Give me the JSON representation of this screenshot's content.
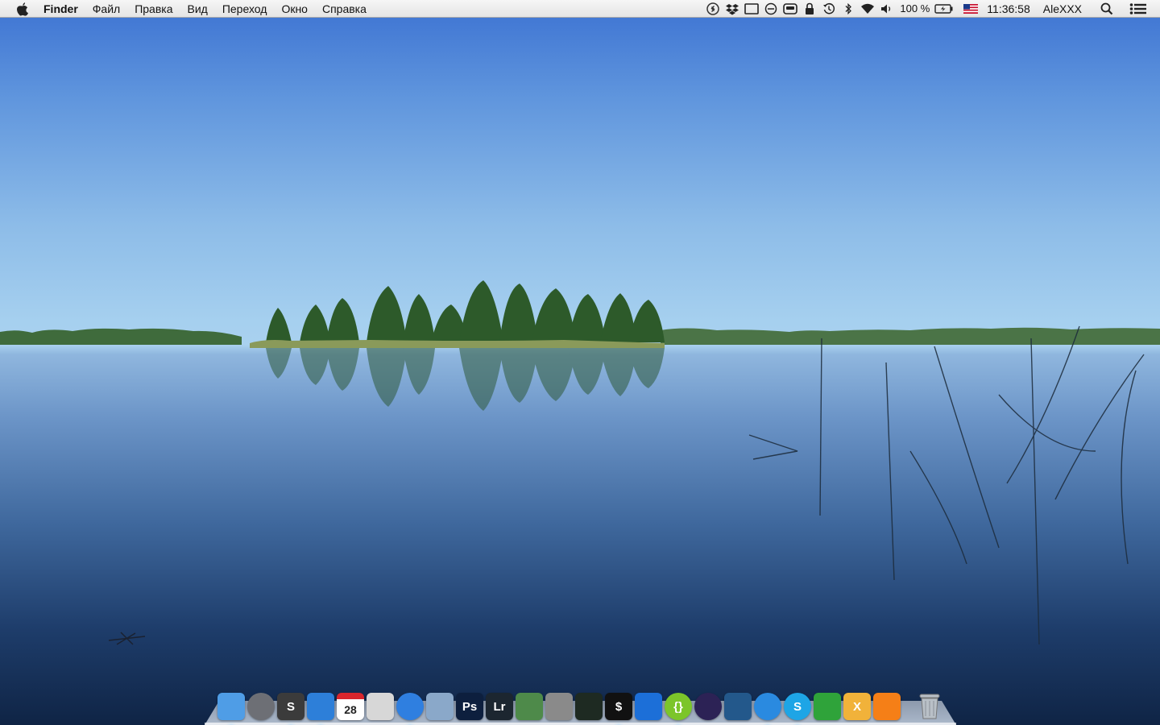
{
  "menubar": {
    "apple_icon": "apple-icon",
    "app_name": "Finder",
    "menus": [
      "Файл",
      "Правка",
      "Вид",
      "Переход",
      "Окно",
      "Справка"
    ],
    "status_icons": [
      "shazam-icon",
      "dropbox-icon",
      "display-icon",
      "sync-icon",
      "controller-icon",
      "lock-icon",
      "time-machine-icon",
      "bluetooth-icon",
      "wifi-icon",
      "volume-icon"
    ],
    "battery_percent": "100 %",
    "battery_icon": "battery-charging-icon",
    "input_source_icon": "us-flag-icon",
    "clock": "11:36:58",
    "user": "AleXXX",
    "spotlight_icon": "spotlight-search-icon",
    "notification_icon": "notification-center-icon"
  },
  "dock": {
    "items": [
      {
        "name": "finder-icon",
        "label": "",
        "color": "#4f9de6",
        "running": true
      },
      {
        "name": "launchpad-icon",
        "label": "",
        "color": "#6d6f75",
        "running": false
      },
      {
        "name": "sublime-text-icon",
        "label": "S",
        "color": "#3b3b3b",
        "running": true
      },
      {
        "name": "cyberduck-icon",
        "label": "",
        "color": "#2d7fd9",
        "running": true
      },
      {
        "name": "calendar-icon",
        "label": "28",
        "color": "#ffffff",
        "running": false
      },
      {
        "name": "calculator-icon",
        "label": "",
        "color": "#d7d7d7",
        "running": false
      },
      {
        "name": "safari-icon",
        "label": "",
        "color": "#2f7fe0",
        "running": true
      },
      {
        "name": "preview-icon",
        "label": "",
        "color": "#8aa8c9",
        "running": false
      },
      {
        "name": "photoshop-icon",
        "label": "Ps",
        "color": "#0d1f3e",
        "running": false
      },
      {
        "name": "lightroom-icon",
        "label": "Lr",
        "color": "#1c2630",
        "running": false
      },
      {
        "name": "image-capture-icon",
        "label": "",
        "color": "#4e8a4a",
        "running": false
      },
      {
        "name": "system-preferences-icon",
        "label": "",
        "color": "#8a8a8a",
        "running": false
      },
      {
        "name": "activity-monitor-icon",
        "label": "",
        "color": "#1e2a22",
        "running": false
      },
      {
        "name": "terminal-icon",
        "label": "$",
        "color": "#111111",
        "running": true
      },
      {
        "name": "webstorm-icon",
        "label": "",
        "color": "#1c6fd8",
        "running": false
      },
      {
        "name": "brackets-icon",
        "label": "{}",
        "color": "#7cc52a",
        "running": true
      },
      {
        "name": "eclipse-icon",
        "label": "",
        "color": "#2c2255",
        "running": false
      },
      {
        "name": "mysql-workbench-icon",
        "label": "",
        "color": "#23588b",
        "running": false
      },
      {
        "name": "itunes-icon",
        "label": "",
        "color": "#2a8ae0",
        "running": true
      },
      {
        "name": "skype-icon",
        "label": "S",
        "color": "#1ea5e6",
        "running": true
      },
      {
        "name": "adium-icon",
        "label": "",
        "color": "#2fa33a",
        "running": false
      },
      {
        "name": "x11-icon",
        "label": "X",
        "color": "#f1b23a",
        "running": false
      },
      {
        "name": "vlc-icon",
        "label": "",
        "color": "#f57f17",
        "running": false
      }
    ],
    "trash": {
      "name": "trash-icon",
      "color": "#b9c0c7"
    }
  }
}
